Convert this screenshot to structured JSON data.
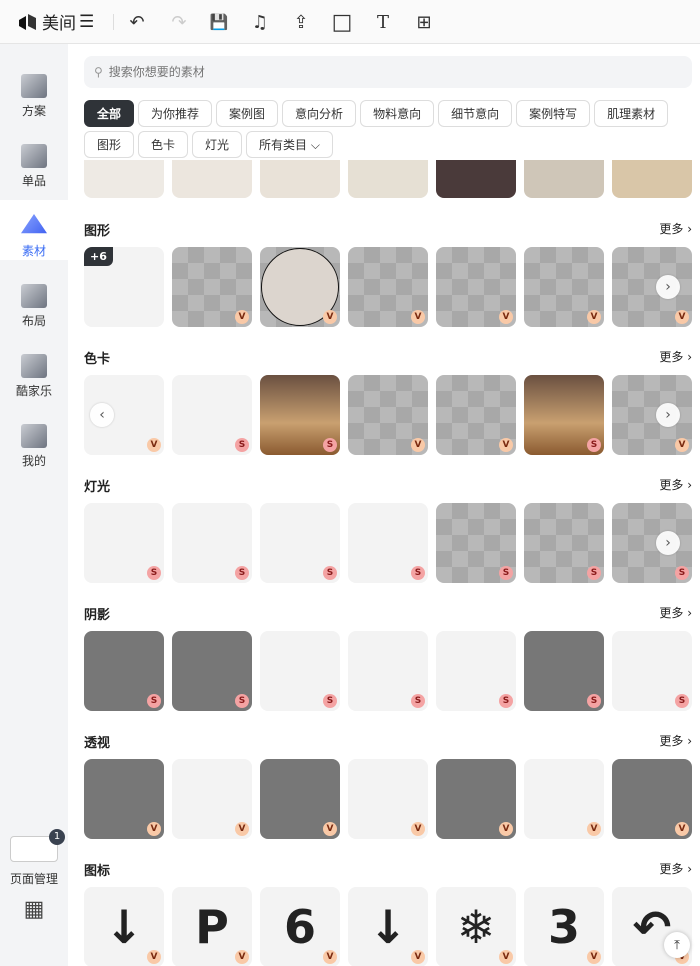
{
  "app": {
    "name": "美间"
  },
  "toolbar": {
    "menu": "☰",
    "undo": "↶",
    "redo": "↷",
    "save": "💾",
    "music": "♫",
    "export": "⇪",
    "shape": "□",
    "text": "T",
    "table": "⊞"
  },
  "sidebar": {
    "items": [
      {
        "label": "方案"
      },
      {
        "label": "单品"
      },
      {
        "label": "素材",
        "active": true
      },
      {
        "label": "布局"
      },
      {
        "label": "酷家乐"
      },
      {
        "label": "我的"
      }
    ],
    "page_manager": {
      "label": "页面管理",
      "count": "1"
    },
    "apps": "▦"
  },
  "search": {
    "placeholder": "搜索你想要的素材"
  },
  "chips": [
    "全部",
    "为你推荐",
    "案例图",
    "意向分析",
    "物料意向",
    "细节意向",
    "案例特写",
    "肌理素材",
    "图形",
    "色卡",
    "灯光",
    "所有类目 ⌵"
  ],
  "more_label": "更多",
  "sections": [
    {
      "title": "图形",
      "plus": "+6",
      "tiles": [
        {
          "t": "plain",
          "b": ""
        },
        {
          "t": "checker",
          "b": "V"
        },
        {
          "t": "circle",
          "b": "V"
        },
        {
          "t": "checker",
          "b": "V"
        },
        {
          "t": "checker",
          "b": "V"
        },
        {
          "t": "checker",
          "b": "V"
        },
        {
          "t": "checker",
          "b": "V"
        }
      ]
    },
    {
      "title": "色卡",
      "tiles": [
        {
          "t": "plain",
          "b": "V"
        },
        {
          "t": "plain",
          "b": "S"
        },
        {
          "t": "photo",
          "b": "S"
        },
        {
          "t": "checker",
          "b": "V"
        },
        {
          "t": "checker",
          "b": "V"
        },
        {
          "t": "photo",
          "b": "S"
        },
        {
          "t": "checker",
          "b": "V"
        }
      ]
    },
    {
      "title": "灯光",
      "tiles": [
        {
          "t": "plain",
          "b": "S"
        },
        {
          "t": "plain",
          "b": "S"
        },
        {
          "t": "plain",
          "b": "S"
        },
        {
          "t": "plain",
          "b": "S"
        },
        {
          "t": "checker",
          "b": "S"
        },
        {
          "t": "checker",
          "b": "S"
        },
        {
          "t": "checker",
          "b": "S"
        }
      ]
    },
    {
      "title": "阴影",
      "tiles": [
        {
          "t": "dark",
          "b": "S"
        },
        {
          "t": "dark",
          "b": "S"
        },
        {
          "t": "plain",
          "b": "S"
        },
        {
          "t": "plain",
          "b": "S"
        },
        {
          "t": "plain",
          "b": "S"
        },
        {
          "t": "dark",
          "b": "S"
        },
        {
          "t": "plain",
          "b": "S"
        }
      ]
    },
    {
      "title": "透视",
      "tiles": [
        {
          "t": "dark",
          "b": "V"
        },
        {
          "t": "plain",
          "b": "V"
        },
        {
          "t": "dark",
          "b": "V"
        },
        {
          "t": "plain",
          "b": "V"
        },
        {
          "t": "dark",
          "b": "V"
        },
        {
          "t": "plain",
          "b": "V"
        },
        {
          "t": "dark",
          "b": "V"
        }
      ]
    },
    {
      "title": "图标",
      "tiles": [
        {
          "t": "plain",
          "b": "V",
          "g": "↓"
        },
        {
          "t": "plain",
          "b": "V",
          "g": "P"
        },
        {
          "t": "plain",
          "b": "V",
          "g": "6"
        },
        {
          "t": "plain",
          "b": "V",
          "g": "↓"
        },
        {
          "t": "plain",
          "b": "V",
          "g": "❄"
        },
        {
          "t": "plain",
          "b": "V",
          "g": "3"
        },
        {
          "t": "plain",
          "b": "V",
          "g": "↶"
        }
      ]
    }
  ]
}
